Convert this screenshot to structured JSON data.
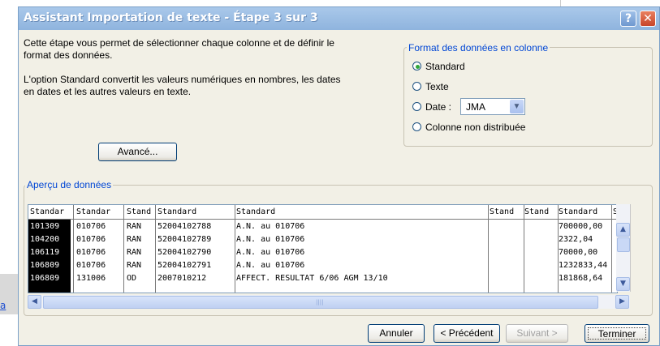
{
  "dialog": {
    "title": "Assistant Importation de texte - Étape 3 sur 3",
    "help_glyph": "?",
    "close_glyph": "✕"
  },
  "intro": {
    "line1": "Cette étape vous permet de sélectionner chaque colonne et de définir le format des données.",
    "line2": "L'option Standard convertit les valeurs numériques en nombres, les dates en dates et les autres valeurs en texte."
  },
  "advanced_button": "Avancé...",
  "format_group": {
    "label": "Format des données en colonne",
    "options": [
      {
        "label": "Standard",
        "selected": true
      },
      {
        "label": "Texte",
        "selected": false
      },
      {
        "label": "Date :",
        "selected": false
      },
      {
        "label": "Colonne non distribuée",
        "selected": false
      }
    ],
    "date_format": "JMA"
  },
  "preview": {
    "label": "Aperçu de données",
    "headers": [
      "Standar",
      "Standar",
      "Stand",
      "Standard",
      "Standard",
      "Stand",
      "Stand",
      "Standard",
      "S"
    ],
    "rows": [
      [
        "101309",
        "010706",
        "RAN",
        "52004102788",
        "A.N.  au 010706",
        "",
        "",
        "700000,00",
        ""
      ],
      [
        "104200",
        "010706",
        "RAN",
        "52004102789",
        "A.N.  au 010706",
        "",
        "",
        "2322,04",
        ""
      ],
      [
        "106119",
        "010706",
        "RAN",
        "52004102790",
        "A.N.  au 010706",
        "",
        "",
        "70000,00",
        ""
      ],
      [
        "106809",
        "010706",
        "RAN",
        "52004102791",
        "A.N.  au 010706",
        "",
        "",
        "1232833,44",
        ""
      ],
      [
        "106809",
        "131006",
        "OD",
        "2007010212",
        "AFFECT. RESULTAT 6/06  AGM 13/10",
        "",
        "",
        "181868,64",
        ""
      ]
    ]
  },
  "buttons": {
    "cancel": "Annuler",
    "previous": "< Précédent",
    "next": "Suivant >",
    "finish": "Terminer"
  },
  "background": {
    "link_fragment": "a"
  },
  "colors": {
    "title_bar": "#a9c8ea",
    "group_label": "#0046d5",
    "radio_selected": "#2fa73a",
    "selected_column": "#000000"
  }
}
